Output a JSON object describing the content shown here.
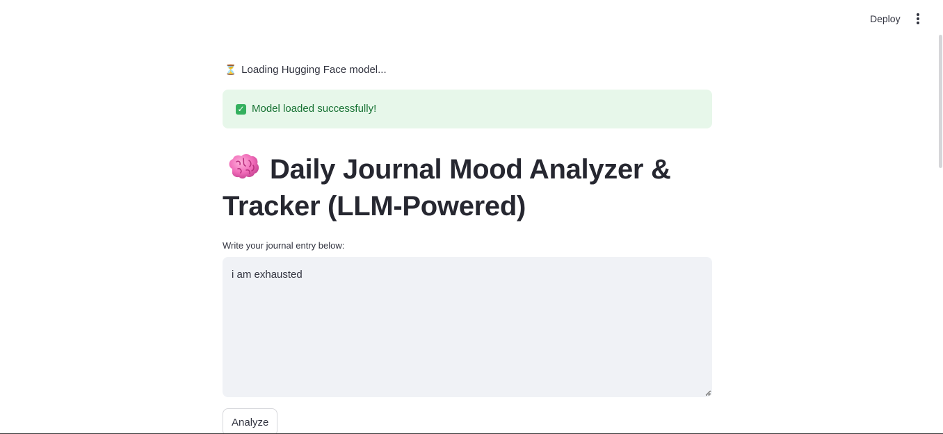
{
  "header": {
    "deploy_label": "Deploy",
    "menu_icon": "more-vertical-icon"
  },
  "status": {
    "loading_icon": "⏳",
    "loading_text": "Loading Hugging Face model...",
    "success_icon": "✓",
    "success_text": "Model loaded successfully!"
  },
  "main": {
    "title_icon": "brain-icon",
    "title": "Daily Journal Mood Analyzer & Tracker (LLM-Powered)",
    "journal_label": "Write your journal entry below:",
    "journal_value": "i am exhausted",
    "analyze_label": "Analyze"
  },
  "colors": {
    "success_bg": "#e7f7ea",
    "success_text": "#177233",
    "text": "#31333f",
    "textarea_bg": "#f0f2f6"
  }
}
